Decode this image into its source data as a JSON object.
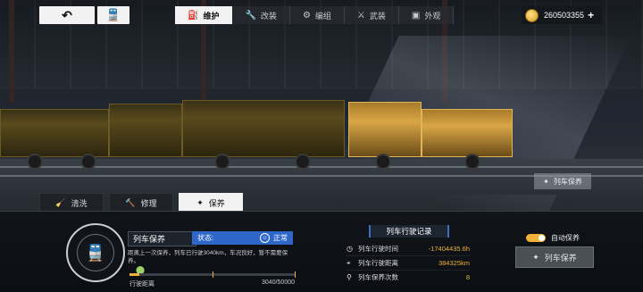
{
  "topbar": {
    "back_icon": "back-arrow-icon",
    "train_icon": "train-icon",
    "tabs": [
      {
        "label": "维护",
        "icon": "maintenance-icon",
        "active": true
      },
      {
        "label": "改装",
        "icon": "wrench-icon",
        "active": false
      },
      {
        "label": "编组",
        "icon": "gear-icon",
        "active": false
      },
      {
        "label": "武装",
        "icon": "weapon-icon",
        "active": false
      },
      {
        "label": "外观",
        "icon": "paint-icon",
        "active": false
      }
    ],
    "currency": {
      "value": "260503355",
      "plus": "+"
    }
  },
  "subtabs": [
    {
      "label": "清洗",
      "icon": "brush-icon",
      "active": false
    },
    {
      "label": "修理",
      "icon": "hammer-icon",
      "active": false
    },
    {
      "label": "保养",
      "icon": "sparkle-icon",
      "active": true
    }
  ],
  "side_button": {
    "label": "列车保养",
    "icon": "sparkle-icon"
  },
  "maintenance": {
    "title": "列车保养",
    "status_label": "状态:",
    "status_value": "正常",
    "description": "距离上一次保养，列车已行驶3040km，车况良好，暂不需要保养。",
    "progress_label": "行驶距离",
    "progress_value": "3040/50000",
    "progress_fraction": 0.0608,
    "accent": "#f0b23a",
    "status_color": "#2f66c9"
  },
  "record": {
    "title": "列车行驶记录",
    "rows": [
      {
        "icon": "clock-icon",
        "label": "列车行驶时间",
        "value": "-17404435.6h"
      },
      {
        "icon": "location-icon",
        "label": "列车行驶距离",
        "value": "384325km"
      },
      {
        "icon": "broom-icon",
        "label": "列车保养次数",
        "value": "8"
      }
    ]
  },
  "auto_maint": {
    "label": "自动保养",
    "enabled": true
  },
  "maint_button": {
    "label": "列车保养",
    "icon": "sparkle-icon"
  }
}
